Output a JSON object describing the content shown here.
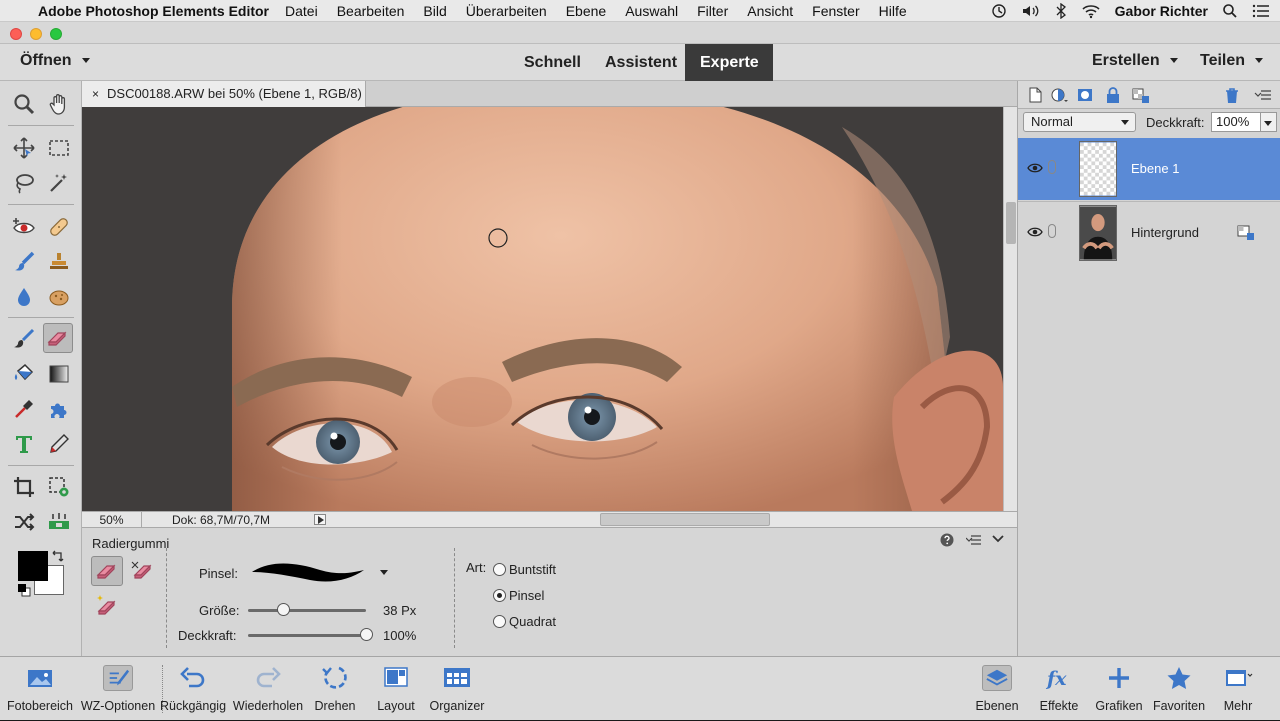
{
  "menubar": {
    "app_name": "Adobe Photoshop Elements Editor",
    "items": [
      "Datei",
      "Bearbeiten",
      "Bild",
      "Überarbeiten",
      "Ebene",
      "Auswahl",
      "Filter",
      "Ansicht",
      "Fenster",
      "Hilfe"
    ],
    "user": "Gabor Richter"
  },
  "modebar": {
    "open_label": "Öffnen",
    "tabs": [
      {
        "label": "Schnell",
        "active": false
      },
      {
        "label": "Assistent",
        "active": false
      },
      {
        "label": "Experte",
        "active": true
      }
    ],
    "create_label": "Erstellen",
    "share_label": "Teilen"
  },
  "document": {
    "tab_close": "×",
    "tab_title": "DSC00188.ARW bei 50% (Ebene 1, RGB/8) *",
    "zoom": "50%",
    "doc_info": "Dok: 68,7M/70,7M"
  },
  "tool_options": {
    "title": "Radiergummi",
    "brush_label": "Pinsel:",
    "size_label": "Größe:",
    "size_value": "38 Px",
    "size_fraction": 0.3,
    "opacity_label": "Deckkraft:",
    "opacity_value": "100%",
    "opacity_fraction": 1.0,
    "type_label": "Art:",
    "types": [
      {
        "label": "Buntstift",
        "selected": false
      },
      {
        "label": "Pinsel",
        "selected": true
      },
      {
        "label": "Quadrat",
        "selected": false
      }
    ]
  },
  "layers_panel": {
    "blend_mode": "Normal",
    "opacity_label": "Deckkraft:",
    "opacity_value": "100%",
    "layers": [
      {
        "name": "Ebene 1",
        "selected": true
      },
      {
        "name": "Hintergrund",
        "selected": false
      }
    ]
  },
  "dock": {
    "left": [
      {
        "label": "Fotobereich",
        "icon": "photo-bin-icon"
      },
      {
        "label": "WZ-Optionen",
        "icon": "tool-options-icon"
      },
      {
        "label": "Rückgängig",
        "icon": "undo-icon"
      },
      {
        "label": "Wiederholen",
        "icon": "redo-icon"
      },
      {
        "label": "Drehen",
        "icon": "rotate-icon"
      },
      {
        "label": "Layout",
        "icon": "layout-icon"
      },
      {
        "label": "Organizer",
        "icon": "organizer-icon"
      }
    ],
    "right": [
      {
        "label": "Ebenen",
        "icon": "layers-icon"
      },
      {
        "label": "Effekte",
        "icon": "fx-icon"
      },
      {
        "label": "Grafiken",
        "icon": "plus-icon"
      },
      {
        "label": "Favoriten",
        "icon": "star-icon"
      },
      {
        "label": "Mehr",
        "icon": "more-icon"
      }
    ]
  },
  "colors": {
    "accent": "#5a8ad6",
    "active_tab": "#3a3a3a",
    "foreground_swatch": "#000000",
    "background_swatch": "#ffffff",
    "icon_blue": "#3d77c8"
  }
}
